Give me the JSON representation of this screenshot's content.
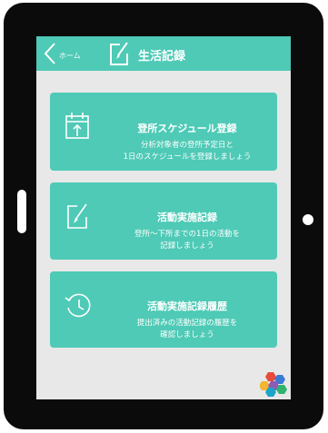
{
  "header": {
    "back_label": "ホーム",
    "title": "生活記録",
    "icon": "edit-note-icon"
  },
  "cards": [
    {
      "title": "登所スケジュール登録",
      "desc_line1": "分析対象者の登所予定日と",
      "desc_line2": "1日のスケジュールを登録しましょう",
      "icon": "calendar-upload-icon"
    },
    {
      "title": "活動実施記録",
      "desc_line1": "登所〜下所までの1日の活動を",
      "desc_line2": "記録しましょう",
      "icon": "edit-note-icon"
    },
    {
      "title": "活動実施記録履歴",
      "desc_line1": "提出済みの活動記録の履歴を",
      "desc_line2": "確認しましょう",
      "icon": "history-icon"
    }
  ],
  "colors": {
    "accent": "#4ecab6",
    "screen_bg": "#e8e8e8",
    "tablet_frame": "#0b0b0b"
  }
}
